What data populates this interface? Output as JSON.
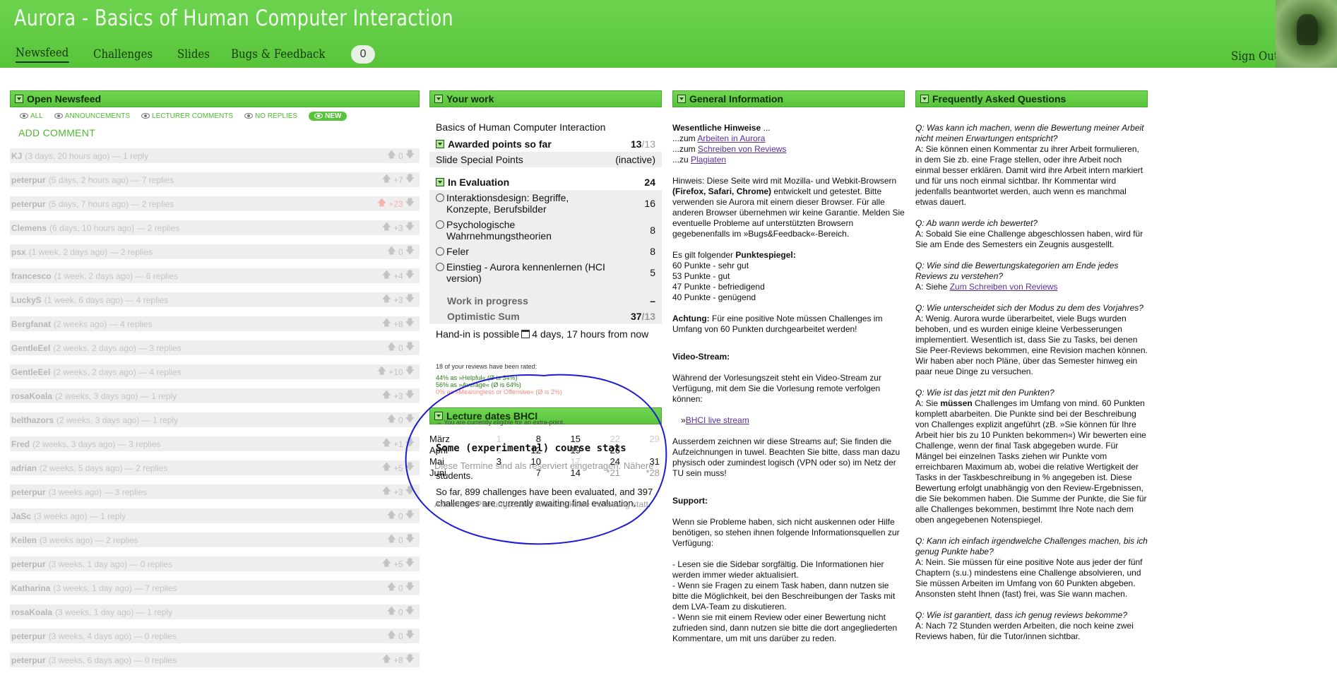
{
  "header": {
    "title": "Aurora - Basics of Human Computer Interaction",
    "nav": [
      "Newsfeed",
      "Challenges",
      "Slides",
      "Bugs & Feedback"
    ],
    "badge": "0",
    "sign_out": "Sign Out"
  },
  "newsfeed": {
    "title": "Open Newsfeed",
    "filters": [
      "ALL",
      "ANNOUNCEMENTS",
      "LECTURER COMMENTS",
      "NO REPLIES",
      "NEW"
    ],
    "add_comment": "ADD COMMENT",
    "items": [
      {
        "author": "KJ",
        "meta": "(3 days, 20 hours ago) — 1 reply",
        "votes": "0"
      },
      {
        "author": "peterpur",
        "meta": "(5 days, 2 hours ago) — 7 replies",
        "votes": "+7"
      },
      {
        "author": "peterpur",
        "meta": "(5 days, 7 hours ago) — 2 replies",
        "votes": "+23"
      },
      {
        "author": "Clemens",
        "meta": "(6 days, 10 hours ago) — 2 replies",
        "votes": "+3"
      },
      {
        "author": "psx",
        "meta": "(1 week, 2 days ago) — 2 replies",
        "votes": "0"
      },
      {
        "author": "francesco",
        "meta": "(1 week, 2 days ago) — 6 replies",
        "votes": "+4"
      },
      {
        "author": "LuckyS",
        "meta": "(1 week, 6 days ago) — 4 replies",
        "votes": "+3"
      },
      {
        "author": "Bergfanat",
        "meta": "(2 weeks ago) — 4 replies",
        "votes": "+8"
      },
      {
        "author": "GentleEel",
        "meta": "(2 weeks, 2 days ago) — 3 replies",
        "votes": "0"
      },
      {
        "author": "GentleEel",
        "meta": "(2 weeks, 2 days ago) — 4 replies",
        "votes": "+10"
      },
      {
        "author": "rosaKoala",
        "meta": "(2 weeks, 3 days ago) — 1 reply",
        "votes": "+3"
      },
      {
        "author": "belthazors",
        "meta": "(2 weeks, 3 days ago) — 1 reply",
        "votes": "0"
      },
      {
        "author": "Fred",
        "meta": "(2 weeks, 3 days ago) — 3 replies",
        "votes": "+1"
      },
      {
        "author": "adrian",
        "meta": "(2 weeks, 5 days ago) — 2 replies",
        "votes": "+5"
      },
      {
        "author": "peterpur",
        "meta": "(3 weeks ago) — 3 replies",
        "votes": "+3"
      },
      {
        "author": "JaSc",
        "meta": "(3 weeks ago) — 1 reply",
        "votes": "0"
      },
      {
        "author": "Keilen",
        "meta": "(3 weeks ago) — 2 replies",
        "votes": "0"
      },
      {
        "author": "peterpur",
        "meta": "(3 weeks, 1 day ago) — 0 replies",
        "votes": "+5"
      },
      {
        "author": "Katharina",
        "meta": "(3 weeks, 1 day ago) — 7 replies",
        "votes": "0"
      },
      {
        "author": "rosaKoala",
        "meta": "(3 weeks, 1 day ago) — 1 reply",
        "votes": "0"
      },
      {
        "author": "peterpur",
        "meta": "(3 weeks, 4 days ago) — 0 replies",
        "votes": "0"
      },
      {
        "author": "peterpur",
        "meta": "(3 weeks, 6 days ago) — 0 replies",
        "votes": "+8"
      }
    ]
  },
  "work": {
    "title": "Your work",
    "course": "Basics of Human Computer Interaction",
    "awarded_label": "Awarded points so far",
    "awarded_value": "13",
    "awarded_total": "/13",
    "special_label": "Slide Special Points",
    "special_value": "(inactive)",
    "eval_label": "In Evaluation",
    "eval_value": "24",
    "eval_items": [
      {
        "label": "Interaktionsdesign: Begriffe, Konzepte, Berufsbilder",
        "value": "16"
      },
      {
        "label": "Psychologische Wahrnehmungstheorien",
        "value": "8"
      },
      {
        "label": "Feler",
        "value": "8"
      },
      {
        "label": "Einstieg - Aurora kennenlernen (HCI version)",
        "value": "5"
      }
    ],
    "wip_label": "Work in progress",
    "wip_value": "–",
    "opt_label": "Optimistic Sum",
    "opt_value": "37",
    "opt_total": "/13",
    "handin_label": "Hand-in is possible",
    "handin_value": "4 days, 17 hours from now",
    "rated": "18 of your reviews have been rated:",
    "helpful": "44% as »Helpful« (Ø is 34%)",
    "average": "56% as »Average« (Ø is 64%)",
    "meaningless": "0% as »Meaningless or Offensive« (Ø is 2%)"
  },
  "lecture": {
    "title": "Lecture dates BHCI",
    "eligible": "→ You are currently eligible for an extra-point.",
    "rows": [
      {
        "month": "März",
        "days": [
          "1",
          "8",
          "15",
          "22",
          "29"
        ]
      },
      {
        "month": "April",
        "days": [
          "5",
          "12",
          "19",
          "26",
          ""
        ]
      },
      {
        "month": "Mai",
        "days": [
          "3",
          "10",
          "17",
          "24",
          "31"
        ]
      },
      {
        "month": "Juni",
        "days": [
          "",
          "7",
          "14",
          "*21",
          "*28"
        ]
      }
    ],
    "stats_title": "Some (experimental) course stats",
    "under_text": "Diese Termine sind als reserviert eingetragen. Nähere",
    "students": "students.",
    "stats_body": "So far, 899 challenges have been evaluated, and 397 challenges are currently awaiting final evaluation.",
    "under_text2": "Aktuellster Planungsstand findet da keine Vorlesung statt."
  },
  "info": {
    "title": "General Information",
    "hints_heading": "Wesentliche Hinweise",
    "hints_suffix": " ...",
    "link_prefix": "...zum ",
    "link_prefix2": "...zu ",
    "link1": "Arbeiten in Aurora",
    "link2": "Schreiben von Reviews",
    "link3": "Plagiaten",
    "hinweis_a": "Hinweis: Diese Seite wird mit Mozilla- und Webkit-Browsern ",
    "hinweis_b": "(Firefox, Safari, Chrome)",
    "hinweis_c": " entwickelt und getestet. Bitte verwenden sie Aurora mit einem dieser Browser. Für alle anderen Browser übernehmen wir keine Garantie. Melden Sie eventuelle Probleme auf unterstützten Browsern gegebenenfalls im »Bugs&Feedback«-Bereich.",
    "punkte_intro": "Es gilt folgender ",
    "punkte_bold": "Punktespiegel:",
    "punkte": [
      "60 Punkte - sehr gut",
      "53 Punkte - gut",
      "47 Punkte - befriedigend",
      "40 Punkte - genügend"
    ],
    "achtung_bold": "Achtung:",
    "achtung": " Für eine positive Note müssen Challenges im Umfang von 60 Punkten durchgearbeitet werden!",
    "video_heading": "Video-Stream:",
    "video_text": "Während der Vorlesungszeit steht ein Video-Stream zur Verfügung, mit dem Sie die Vorlesung remote verfolgen können:",
    "stream_arrow": "»",
    "stream_link": "BHCI live stream",
    "record_text": "Ausserdem zeichnen wir diese Streams auf; Sie finden die Aufzeichnungen in tuwel. Beachten Sie bitte, dass man dazu physisch oder zumindest logisch (VPN oder so) im Netz der TU sein muss!",
    "support_heading": "Support:",
    "support_text": "Wenn sie Probleme haben, sich nicht auskennen oder Hilfe benötigen, so stehen ihnen folgende Informationsquellen zur Verfügung:",
    "support_items": [
      "- Lesen sie die Sidebar sorgfältig. Die Informationen hier werden immer wieder aktualisiert.",
      "- Wenn sie Fragen zu einem Task haben, dann nutzen sie bitte die Möglichkeit, bei den Beschreibungen der Tasks mit dem LVA-Team zu diskutieren.",
      "- Wenn sie mit einem Review oder einer Bewertung nicht zufrieden sind, dann nutzen sie bitte die dort angegliederten Kommentare, um mit uns darüber zu reden."
    ]
  },
  "faq": {
    "title": "Frequently Asked Questions",
    "q1": "Q: Was kann ich machen, wenn die Bewertung meiner Arbeit nicht meinen Erwartungen entspricht?",
    "a1": "A: Sie können einen Kommentar zu ihrer Arbeit formulieren, in dem Sie zb. eine Frage stellen, oder ihre Arbeit noch einmal besser erklären. Damit wird ihre Arbeit intern markiert und für uns noch einmal sichtbar. Ihr Kommentar wird jedenfalls beantwortet werden, auch wenn es manchmal etwas dauert.",
    "q2": "Q: Ab wann werde ich bewertet?",
    "a2": "A: Sobald Sie eine Challenge abgeschlossen haben, wird für Sie am Ende des Semesters ein Zeugnis ausgestellt.",
    "q3": "Q: Wie sind die Bewertungskategorien am Ende jedes Reviews zu verstehen?",
    "a3_prefix": "A: Siehe ",
    "a3_link": "Zum Schreiben von Reviews",
    "q4": "Q: Wie unterscheidet sich der Modus zu dem des Vorjahres?",
    "a4": "A: Wenig. Aurora wurde überarbeitet, viele Bugs wurden behoben, und es wurden einige kleine Verbesserungen implementiert. Wesentlich ist, dass Sie zu Tasks, bei denen Sie Peer-Reviews bekommen, eine Revision machen können. Wir haben aber noch Pläne, über das Semester hinweg ein paar neue Dinge zu versuchen.",
    "q5": "Q: Wie ist das jetzt mit den Punkten?",
    "a5_a": "A: Sie ",
    "a5_bold": "müssen",
    "a5_b": " Challenges im Umfang von mind. 60 Punkten komplett abarbeiten. Die Punkte sind bei der Beschreibung von Challenges explizit angeführt (zB. »Sie können für Ihre Arbeit hier bis zu 10 Punkten bekommen«) Wir bewerten eine Challenge, wenn der final Task abgegeben wurde. Für Mängel bei einzelnen Tasks ziehen wir Punkte vom erreichbaren Maximum ab, wobei die relative Wertigkeit der Tasks in der Taskbeschreibung in % angegeben ist. Diese Bewertung erfolgt unabhängig von den Review-Ergebnissen, die Sie bekommen haben. Die Summe der Punkte, die Sie für alle Challenges bekommen, bestimmt Ihre Note nach dem oben angegebenen Notenspiegel.",
    "q6": "Q: Kann ich einfach irgendwelche Challenges machen, bis ich genug Punkte habe?",
    "a6": "A: Nein. Sie müssen für eine positive Note aus jeder der fünf Chaptern (s.u.) mindestens eine Challenge absolvieren, und Sie müssen Arbeiten im Umfang von 60 Punkten abgeben. Ansonsten steht Ihnen (fast) frei, was Sie wann machen.",
    "q7": "Q: Wie ist garantiert, dass ich genug reviews bekomme?",
    "a7": "A: Nach 72 Stunden werden Arbeiten, die noch keine zwei Reviews haben, für die Tutor/innen sichtbar."
  }
}
